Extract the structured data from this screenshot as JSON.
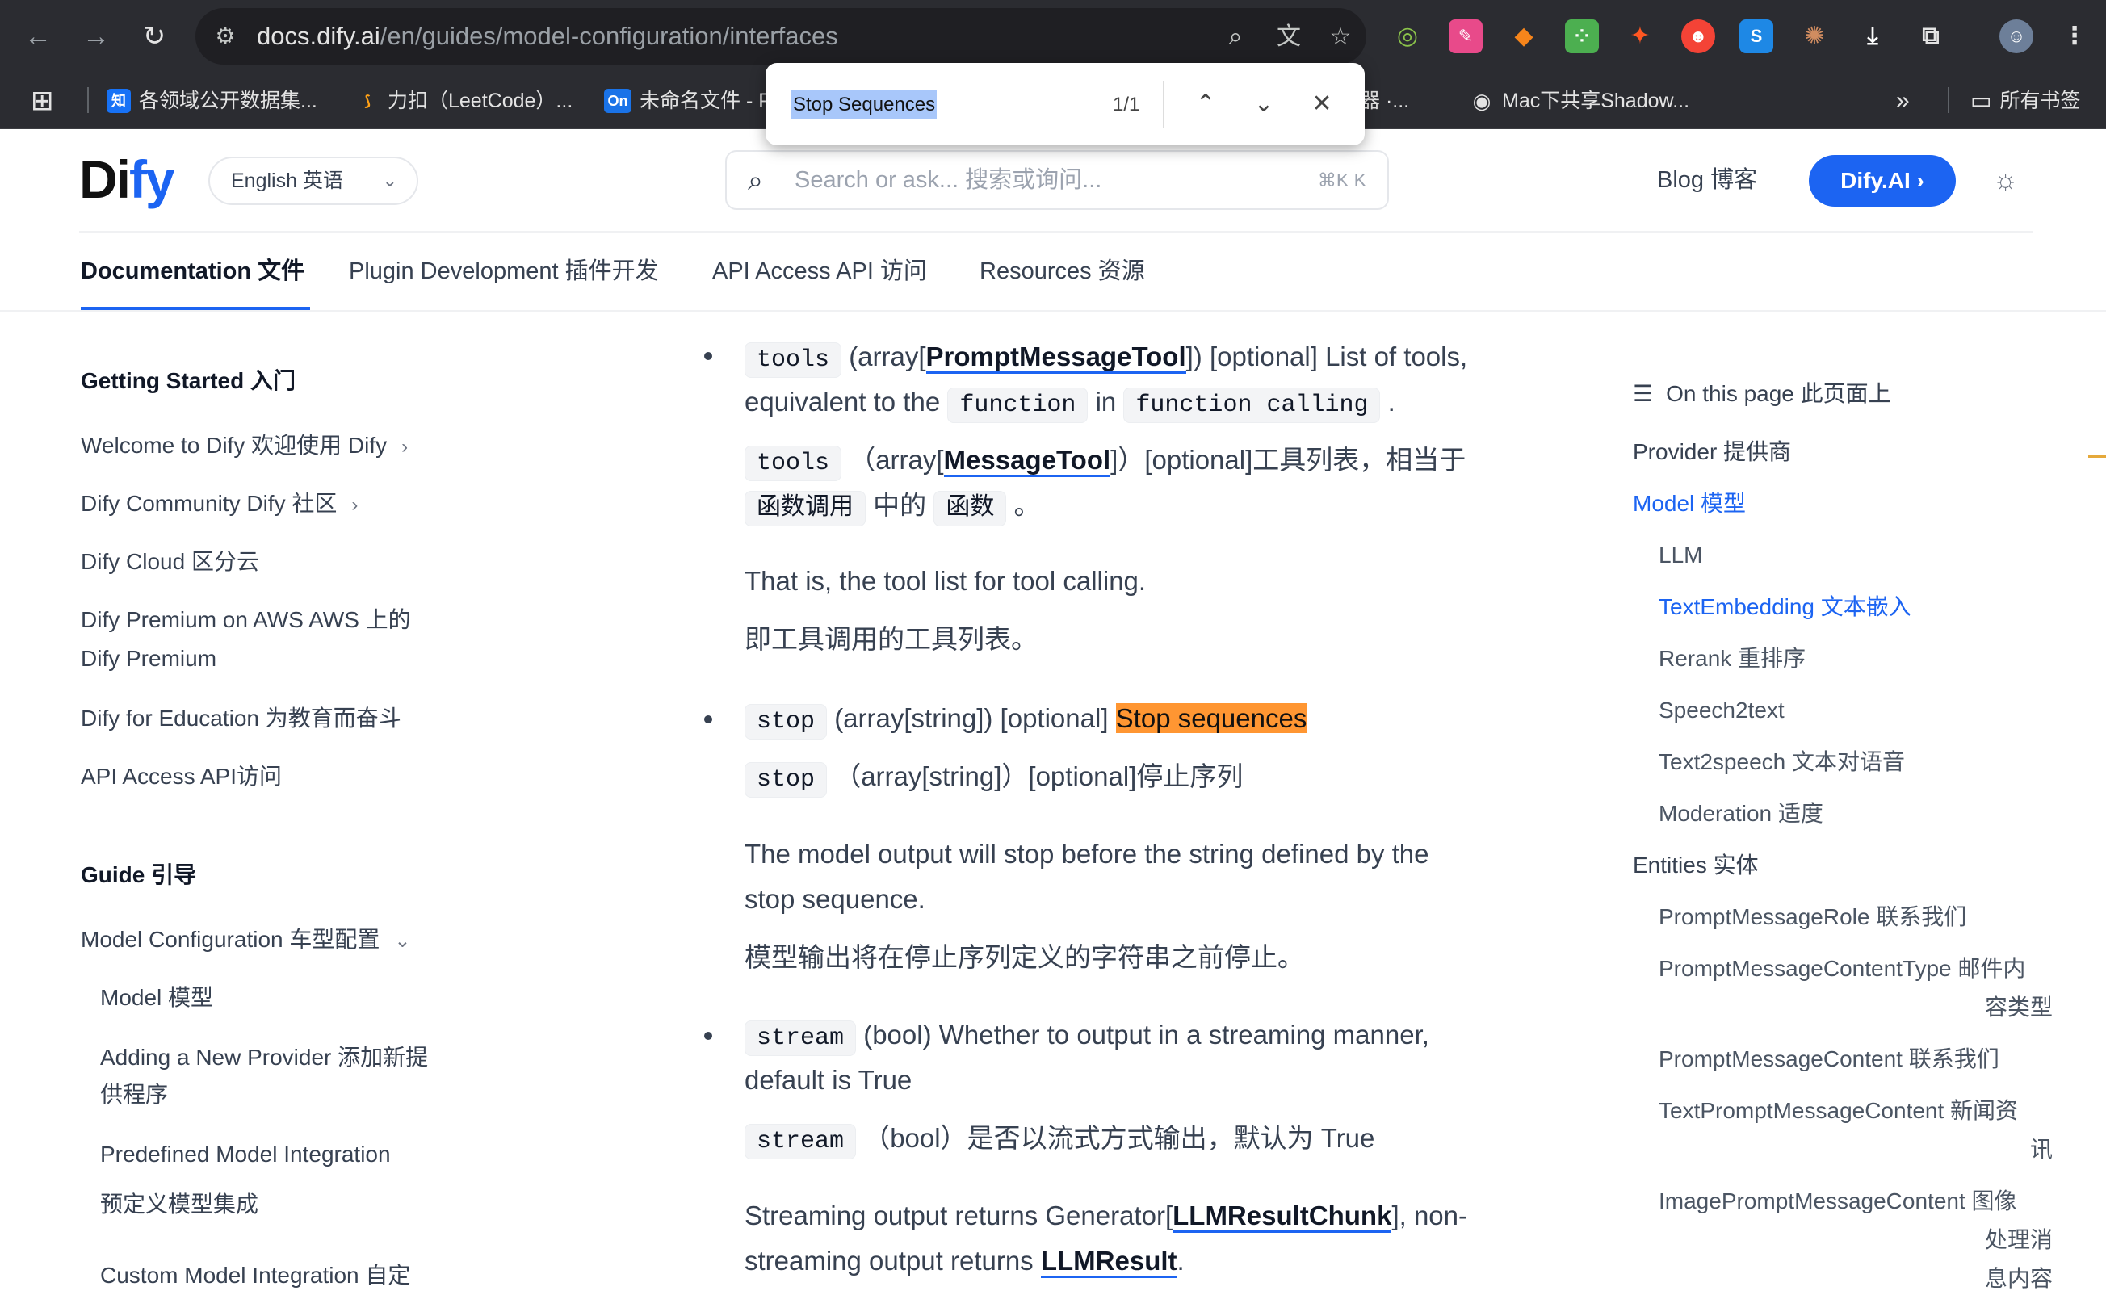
{
  "browser": {
    "url_domain": "docs.dify.ai",
    "url_path": "/en/guides/model-configuration/interfaces",
    "bookmarks": [
      {
        "label": "各领域公开数据集...",
        "fav": "知",
        "color": "#1772f6"
      },
      {
        "label": "力扣（LeetCode）...",
        "fav": "⟆",
        "color": "#ffa116"
      },
      {
        "label": "未命名文件 - P",
        "fav": "On",
        "color": "#1a73e8"
      },
      {
        "label": "器 ·...",
        "fav": "",
        "color": ""
      },
      {
        "label": "Mac下共享Shadow...",
        "fav": "◉",
        "color": "#e3e3e3"
      }
    ],
    "all_bookmarks": "所有书签",
    "more": "»"
  },
  "findbar": {
    "query": "Stop Sequences",
    "count": "1/1"
  },
  "header": {
    "logo_prefix": "Di",
    "logo_suffix": "fy",
    "language": "English  英语",
    "search_placeholder": "Search or ask...  搜索或询问...",
    "search_shortcut": "⌘K  K",
    "blog": "Blog  博客",
    "dify_button": "Dify.AI"
  },
  "tabs": [
    {
      "label": "Documentation  文件"
    },
    {
      "label": "Plugin Development  插件开发"
    },
    {
      "label": "API Access  API 访问"
    },
    {
      "label": "Resources  资源"
    }
  ],
  "sidebar": {
    "getting_started": "Getting Started  入门",
    "items": [
      "Welcome to Dify  欢迎使用 Dify",
      "Dify Community  Dify 社区",
      "Dify Cloud  区分云",
      "Dify Premium on AWS  AWS 上的",
      "Dify Premium",
      "Dify for Education  为教育而奋斗",
      "API Access  API访问"
    ],
    "guide": "Guide  引导",
    "guide_items": [
      "Model Configuration  车型配置",
      "Model  模型",
      "Adding a New Provider  添加新提",
      "供程序",
      "Predefined Model Integration",
      "预定义模型集成",
      "Custom Model Integration  自定"
    ]
  },
  "content": {
    "tools_code": "tools",
    "tools_en_1": "(array[",
    "tools_link": "PromptMessageTool",
    "tools_en_2": "]) [optional] List of tools,",
    "tools_en_3": "equivalent to the",
    "function_code": "function",
    "in_word": "in",
    "function_calling_code": "function calling",
    "period": ".",
    "tools_zh_1": "（array[",
    "tools_zh_link": "MessageTool",
    "tools_zh_2": "]）[optional]工具列表，相当于",
    "tools_zh_code1": "函数调用",
    "tools_zh_mid": "中的",
    "tools_zh_code2": "函数",
    "tools_zh_end": "。",
    "tools_para_en": "That is, the tool list for tool calling.",
    "tools_para_zh": "即工具调用的工具列表。",
    "stop_code": "stop",
    "stop_en": "(array[string]) [optional]",
    "stop_highlight": "Stop sequences",
    "stop_zh": "（array[string]）[optional]停止序列",
    "stop_para_en_1": "The model output will stop before the string defined by the",
    "stop_para_en_2": "stop sequence.",
    "stop_para_zh": "模型输出将在停止序列定义的字符串之前停止。",
    "stream_code": "stream",
    "stream_en_1": "(bool) Whether to output in a streaming manner,",
    "stream_en_2": "default is True",
    "stream_zh": "（bool）是否以流式方式输出，默认为 True",
    "stream_para_1": "Streaming output returns Generator[",
    "stream_link1": "LLMResultChunk",
    "stream_para_2": "], non-",
    "stream_para_3": "streaming output returns",
    "stream_link2": "LLMResult",
    "stream_para_4": "."
  },
  "toc": {
    "title": "On this page  此页面上",
    "items": [
      {
        "label": "Provider  提供商",
        "level": "h",
        "active": false
      },
      {
        "label": "Model  模型",
        "level": "h",
        "active": true
      },
      {
        "label": "LLM",
        "level": "s",
        "active": false
      },
      {
        "label": "TextEmbedding  文本嵌入",
        "level": "s",
        "active": true
      },
      {
        "label": "Rerank  重排序",
        "level": "s",
        "active": false
      },
      {
        "label": "Speech2text",
        "level": "s",
        "active": false
      },
      {
        "label": "Text2speech  文本对语音",
        "level": "s",
        "active": false
      },
      {
        "label": "Moderation  适度",
        "level": "s",
        "active": false
      },
      {
        "label": "Entities  实体",
        "level": "h",
        "active": false
      },
      {
        "label": "PromptMessageRole  联系我们",
        "level": "s",
        "active": false
      },
      {
        "label": "PromptMessageContentType  邮件内",
        "level": "s",
        "active": false
      },
      {
        "label": "容类型",
        "level": "c",
        "active": false
      },
      {
        "label": "PromptMessageContent  联系我们",
        "level": "s",
        "active": false
      },
      {
        "label": "TextPromptMessageContent  新闻资",
        "level": "s",
        "active": false
      },
      {
        "label": "讯",
        "level": "c",
        "active": false
      },
      {
        "label": "ImagePromptMessageContent  图像",
        "level": "s",
        "active": false
      },
      {
        "label": "处理消",
        "level": "c",
        "active": false
      },
      {
        "label": "息内容",
        "level": "c",
        "active": false
      }
    ]
  }
}
